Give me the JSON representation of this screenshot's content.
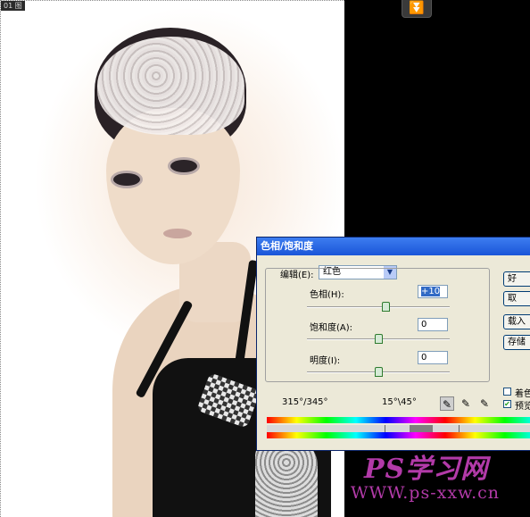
{
  "document": {
    "tab_label": "01 图"
  },
  "dialog": {
    "title": "色相/饱和度",
    "edit_label": "编辑(E):",
    "edit_value": "红色",
    "hue": {
      "label": "色相(H):",
      "value": "+10",
      "slider_level": 0.55
    },
    "saturation": {
      "label": "饱和度(A):",
      "value": "0",
      "slider_level": 0.5
    },
    "lightness": {
      "label": "明度(I):",
      "value": "0",
      "slider_level": 0.5
    },
    "range_outer": "315°/345°",
    "range_inner": "15°\\45°",
    "buttons": {
      "ok": "好",
      "cancel": "取",
      "load": "载入",
      "save": "存储"
    },
    "colorize": {
      "label": "着色",
      "checked": false
    },
    "preview": {
      "label": "预览",
      "checked": true
    }
  },
  "watermark": {
    "logo": "PS学习网",
    "url": "WWW.ps-xxw.cn"
  },
  "colors": {
    "title_bar": "#1a55d8",
    "watermark": "#b23aa8",
    "canvas_bg": "#000000"
  },
  "icons": [
    "double-chevron-down-icon",
    "eyedropper-icon",
    "eyedropper-plus-icon",
    "eyedropper-minus-icon"
  ]
}
